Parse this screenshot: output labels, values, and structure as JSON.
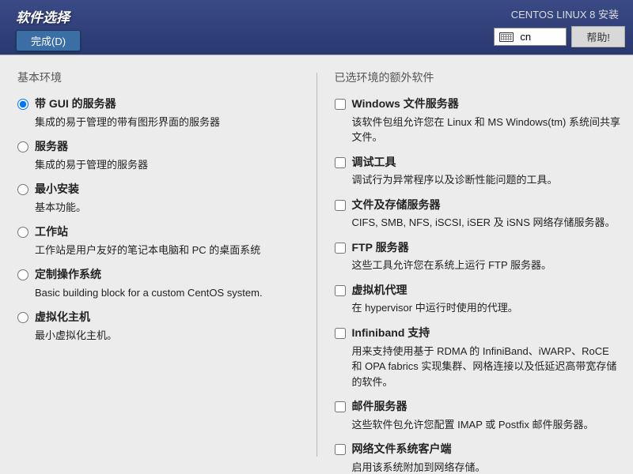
{
  "header": {
    "title": "软件选择",
    "done_label": "完成(D)",
    "install_label": "CENTOS LINUX 8 安装",
    "lang_code": "cn",
    "help_label": "帮助!"
  },
  "base_env": {
    "title": "基本环境",
    "options": [
      {
        "label": "带 GUI 的服务器",
        "desc": "集成的易于管理的带有图形界面的服务器",
        "selected": true
      },
      {
        "label": "服务器",
        "desc": "集成的易于管理的服务器",
        "selected": false
      },
      {
        "label": "最小安装",
        "desc": "基本功能。",
        "selected": false
      },
      {
        "label": "工作站",
        "desc": "工作站是用户友好的笔记本电脑和 PC 的桌面系统",
        "selected": false
      },
      {
        "label": "定制操作系统",
        "desc": "Basic building block for a custom CentOS system.",
        "selected": false
      },
      {
        "label": "虚拟化主机",
        "desc": "最小虚拟化主机。",
        "selected": false
      }
    ]
  },
  "addons": {
    "title": "已选环境的额外软件",
    "options": [
      {
        "label": "Windows 文件服务器",
        "desc": "该软件包组允许您在 Linux 和 MS Windows(tm) 系统间共享文件。"
      },
      {
        "label": "调试工具",
        "desc": "调试行为异常程序以及诊断性能问题的工具。"
      },
      {
        "label": "文件及存储服务器",
        "desc": "CIFS, SMB, NFS, iSCSI, iSER 及 iSNS 网络存储服务器。"
      },
      {
        "label": "FTP 服务器",
        "desc": "这些工具允许您在系统上运行 FTP 服务器。"
      },
      {
        "label": "虚拟机代理",
        "desc": "在 hypervisor 中运行时使用的代理。"
      },
      {
        "label": "Infiniband 支持",
        "desc": "用来支持使用基于 RDMA 的 InfiniBand、iWARP、RoCE 和 OPA fabrics 实现集群、网格连接以及低延迟高带宽存储的软件。"
      },
      {
        "label": "邮件服务器",
        "desc": "这些软件包允许您配置 IMAP 或 Postfix 邮件服务器。"
      },
      {
        "label": "网络文件系统客户端",
        "desc": "启用该系统附加到网络存储。"
      }
    ]
  }
}
